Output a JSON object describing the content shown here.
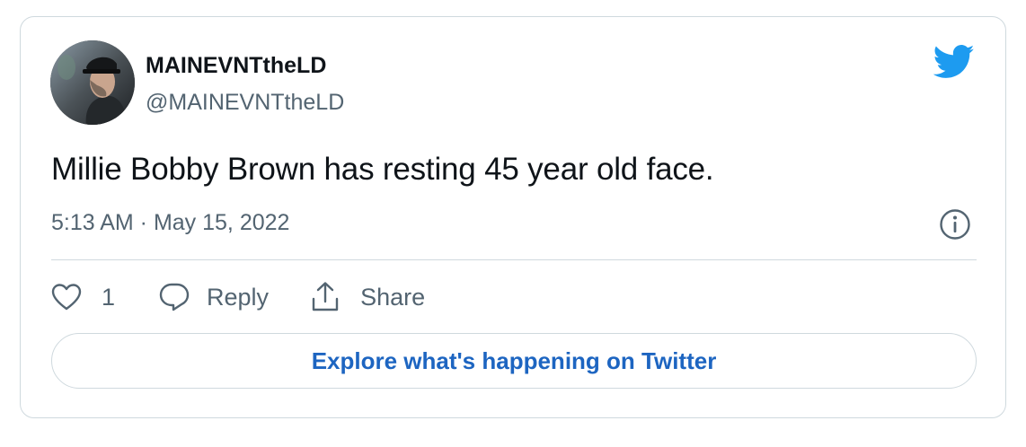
{
  "tweet": {
    "author": {
      "display_name": "MAINEVNTtheLD",
      "handle": "@MAINEVNTtheLD",
      "avatar_icon": "user-avatar-photo"
    },
    "text": "Millie Bobby Brown has resting 45 year old face.",
    "timestamp": "5:13 AM · May 15, 2022",
    "brand_icon": "twitter-bird-icon",
    "actions": {
      "like_count": "1",
      "reply_label": "Reply",
      "share_label": "Share"
    },
    "explore_label": "Explore what's happening on Twitter"
  },
  "colors": {
    "brand": "#1d9bf0",
    "link": "#1d65c1",
    "secondary_text": "#536471",
    "border": "#cfd9de"
  }
}
